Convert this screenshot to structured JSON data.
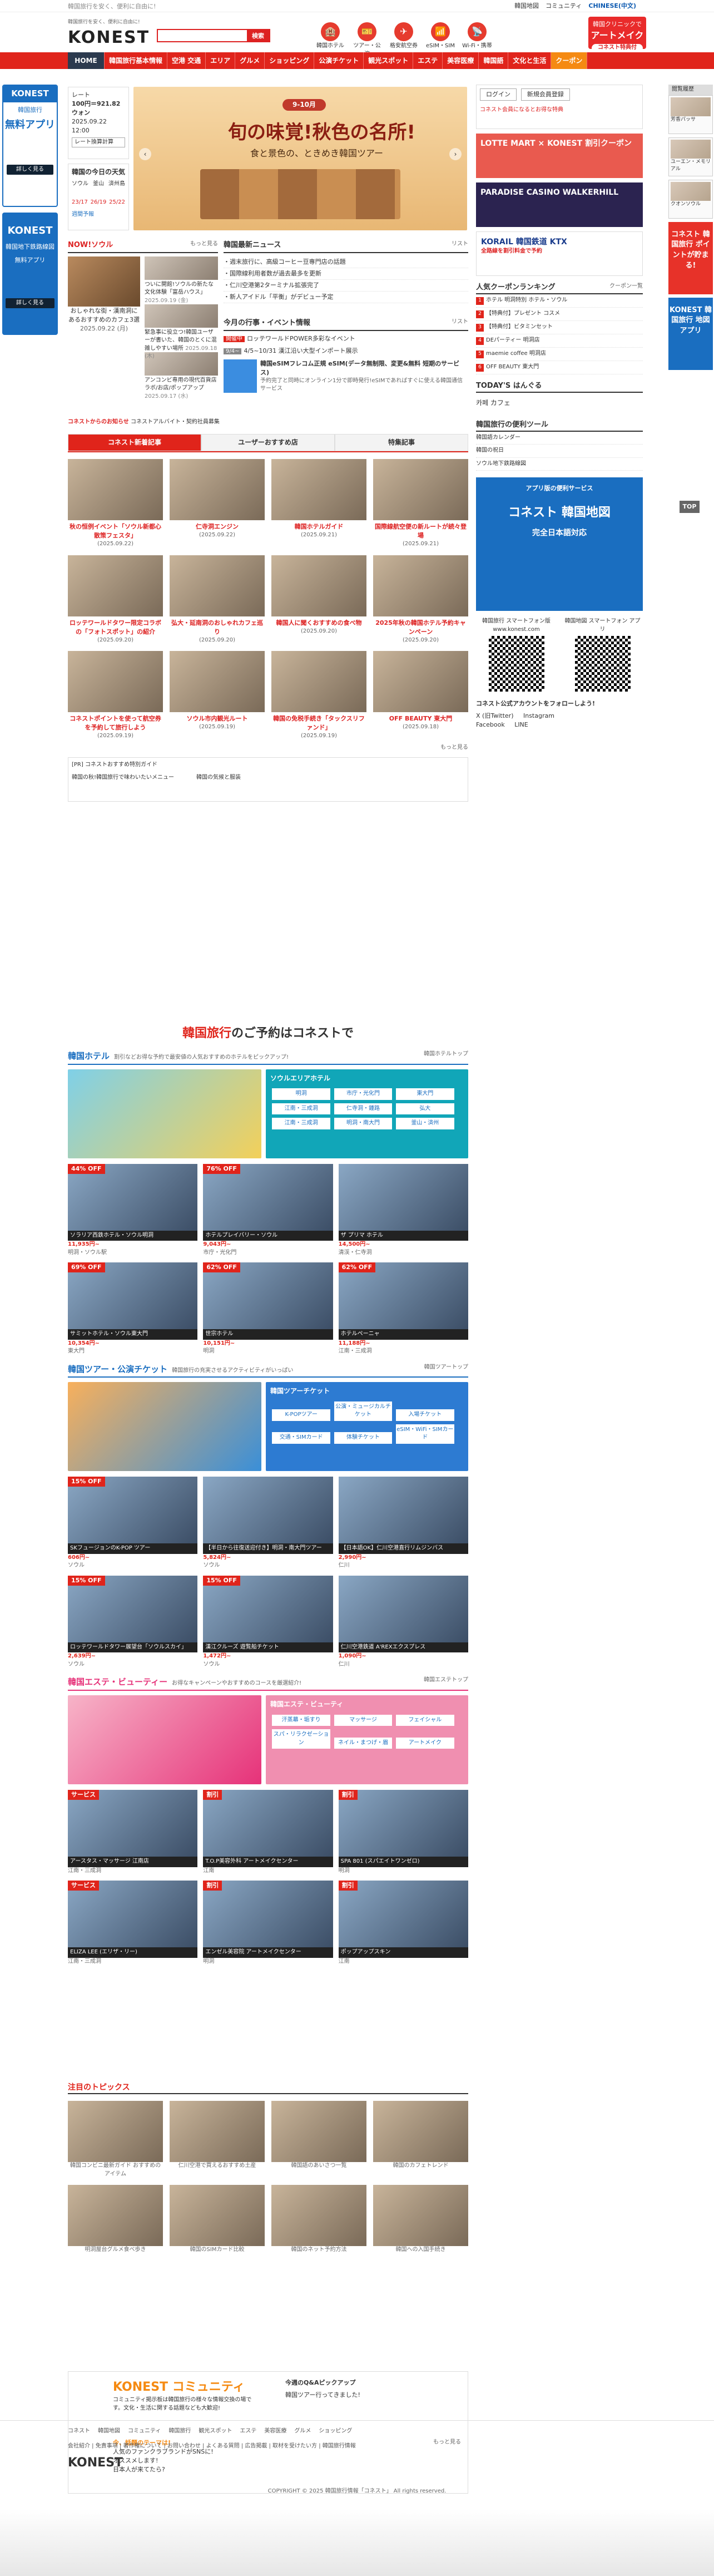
{
  "topbar": {
    "tagline": "韓国旅行を安く、便利に自由に!",
    "links": [
      "韓国地図",
      "コミュニティ",
      "CHINESE(中文)"
    ]
  },
  "header": {
    "logo_small": "韓国旅行を安く、便利に自由に!",
    "logo": "KONEST",
    "search_placeholder": "",
    "search_button": "検索",
    "icons": [
      {
        "label": "韓国ホテル",
        "icon": "hotel-icon",
        "glyph": "🏨"
      },
      {
        "label": "ツアー・公演",
        "icon": "ticket-icon",
        "glyph": "🎫"
      },
      {
        "label": "格安航空券",
        "icon": "plane-icon",
        "glyph": "✈"
      },
      {
        "label": "eSIM・SIM",
        "icon": "sim-icon",
        "glyph": "📶"
      },
      {
        "label": "Wi-Fi・携帯",
        "icon": "wifi-icon",
        "glyph": "📡"
      }
    ],
    "promo_line1": "韓国クリニックで",
    "promo_line2": "アートメイク",
    "promo_line3": "コネスト特典付"
  },
  "nav": [
    "HOME",
    "韓国旅行基本情報",
    "空港 交通",
    "エリア",
    "グルメ",
    "ショッピング",
    "公演チケット",
    "観光スポット",
    "エステ",
    "美容医療",
    "韓国語",
    "文化と生活",
    "クーポン"
  ],
  "left_rail": {
    "b1_title": "KONEST",
    "b1_sub": "韓国旅行",
    "b1_big": "無料アプリ",
    "b1_btn": "詳しく見る",
    "b2_title": "KONEST",
    "b2_big": "韓国地下鉄路線図",
    "b2_sub": "無料アプリ",
    "b2_btn": "詳しく見る"
  },
  "right_rail": {
    "title": "閲覧履歴",
    "items": [
      "芳香パッサ",
      "ユーエン・メモリアル",
      "クオンソウル"
    ],
    "banner1": "コネスト 韓国旅行 ポイントが貯まる!",
    "banner2": "KONEST 韓国旅行 地図アプリ",
    "top": "TOP"
  },
  "rate": {
    "label": "レート",
    "value": "100円＝921.82ウォン",
    "date": "2025.09.22 12:00",
    "btn": "レート換算計算"
  },
  "weather": {
    "title": "韓国の今日の天気",
    "cities": [
      "ソウル",
      "釜山",
      "済州島"
    ],
    "temps": [
      "23/17",
      "26/19",
      "25/22"
    ],
    "link": "週間予報"
  },
  "hero": {
    "pill": "9-10月",
    "headline": "旬の味覚!秋色の名所!",
    "sub": "食と景色の、ときめき韓国ツアー"
  },
  "now_seoul": {
    "title": "NOW!ソウル",
    "more": "もっと見る",
    "main_caption": "おしゃれな街・漢南洞にあるおすすめのカフェ3選",
    "main_date": "2025.09.22 (月)",
    "items": [
      {
        "t": "ついに開館!ソウルの新たな文化体験「富岳ハウス」",
        "d": "2025.09.19 (金)"
      },
      {
        "t": "緊急事に役立つ!韓国ユーザーが書いた、韓国のとくに混雑しやすい場所",
        "d": "2025.09.18 (木)"
      },
      {
        "t": "アンコンビ専用の現代百貨店ラボ/お店/ポップアップ",
        "d": "2025.09.17 (水)"
      }
    ]
  },
  "news": {
    "title": "韓国最新ニュース",
    "more": "リスト",
    "items": [
      "・週末旅行に、高級コーヒー豆専門店の話題",
      "・国際線利用者数が過去最多を更新",
      "・仁川空港第2ターミナル拡張完了",
      "・新人アイドル「平衡」がデビュー予定"
    ]
  },
  "event": {
    "title": "今月の行事・イベント情報",
    "more": "リスト",
    "r1_lbl": "開催中",
    "r1": "ロッテワールドPOWER多彩なイベント",
    "r2_lbl": "9/4~",
    "r2": "4/5~10/31 漢江沿い大型インポート展示",
    "feat_title": "韓国eSIMフレコム正規 eSIM(データ無制限、変更&無料 短期のサービス)",
    "feat_desc": "予約完了と同時にオンライン1分で即時発行!eSIMであればすぐに使える韓国通信サービス"
  },
  "konest_info": {
    "label": "コネストからのお知らせ",
    "text": "コネストアルバイト・契約社員募集"
  },
  "article_tabs": [
    "コネスト新着記事",
    "ユーザーおすすめ店",
    "特集記事"
  ],
  "articles": [
    {
      "t": "秋の恒例イベント「ソウル新都心散策フェスタ」",
      "d": "(2025.09.22)"
    },
    {
      "t": "仁寺洞エンジン",
      "d": "(2025.09.22)"
    },
    {
      "t": "韓国ホテルガイド",
      "d": "(2025.09.21)"
    },
    {
      "t": "国際線航空便の新ルートが続々登場",
      "d": "(2025.09.21)"
    },
    {
      "t": "ロッテワールドタワー限定コラボの「フォトスポット」の紹介",
      "d": "(2025.09.20)"
    },
    {
      "t": "弘大・延南洞のおしゃれカフェ巡り",
      "d": "(2025.09.20)"
    },
    {
      "t": "韓国人に聞くおすすめの食べ物",
      "d": "(2025.09.20)"
    },
    {
      "t": "2025年秋の韓国ホテル予約キャンペーン",
      "d": "(2025.09.20)"
    },
    {
      "t": "コネストポイントを使って航空券を予約して旅行しよう",
      "d": "(2025.09.19)"
    },
    {
      "t": "ソウル市内観光ルート",
      "d": "(2025.09.19)"
    },
    {
      "t": "韓国の免税手続き「タックスリファンド」",
      "d": "(2025.09.19)"
    },
    {
      "t": "OFF BEAUTY 東大門",
      "d": "(2025.09.18)"
    }
  ],
  "articles_more": "もっと見る",
  "special_box": {
    "label": "[PR] コネストおすすめ特別ガイド",
    "a": "韓国の秋!韓国旅行で味わいたいメニュー",
    "b": "韓国の気候と服装"
  },
  "booking": {
    "title_pre": "韓国旅行",
    "title_post": "のご予約はコネストで",
    "hotel": {
      "title": "韓国ホテル",
      "sub": "割引などお得な予約で最安値の人気おすすめのホテルをピックアップ!",
      "more": "韓国ホテルトップ",
      "panel_title": "ソウルエリアホテル",
      "cells": [
        "明洞",
        "市庁・光化門",
        "東大門",
        "江南・三成洞",
        "仁寺洞・鍾路",
        "弘大",
        "江南・三成洞",
        "明洞・南大門",
        "釜山・済州"
      ]
    },
    "hotels": [
      {
        "off": "44% OFF",
        "name": "ソラリア西鉄ホテル・ソウル明洞",
        "price": "11,935円~",
        "loc": "明洞・ソウル駅"
      },
      {
        "off": "76% OFF",
        "name": "ホテルプレイバリー・ソウル",
        "price": "9,043円~",
        "loc": "市庁・光化門"
      },
      {
        "off": "",
        "name": "ザ プリマ ホテル",
        "price": "14,500円~",
        "loc": "清渓・仁寺洞"
      },
      {
        "off": "69% OFF",
        "name": "サミットホテル・ソウル東大門",
        "price": "10,354円~",
        "loc": "東大門"
      },
      {
        "off": "62% OFF",
        "name": "世宗ホテル",
        "price": "10,151円~",
        "loc": "明洞"
      },
      {
        "off": "62% OFF",
        "name": "ホテルペーニャ",
        "price": "11,188円~",
        "loc": "江南・三成洞"
      }
    ],
    "tour": {
      "title": "韓国ツアー・公演チケット",
      "sub": "韓国旅行の充実させるアクティビティがいっぱい",
      "more": "韓国ツアートップ",
      "panel_title": "韓国ツアーチケット",
      "cells": [
        "K-POPツアー",
        "公演・ミュージカルチケット",
        "入場チケット",
        "交通・SIMカード",
        "体験チケット",
        "eSIM・WiFi・SIMカード"
      ]
    },
    "tours": [
      {
        "off": "15% OFF",
        "name": "SKフュージョンのK-POP ツアー",
        "price": "606円~",
        "loc": "ソウル"
      },
      {
        "off": "",
        "name": "【半日から往復送迎付き】明洞・南大門ツアー",
        "price": "5,824円~",
        "loc": "ソウル"
      },
      {
        "off": "",
        "name": "【日本語OK】仁川空港直行リムジンバス",
        "price": "2,990円~",
        "loc": "仁川"
      },
      {
        "off": "15% OFF",
        "name": "ロッテワールドタワー展望台「ソウルスカイ」",
        "price": "2,639円~",
        "loc": "ソウル"
      },
      {
        "off": "15% OFF",
        "name": "漢江クルーズ 遊覧船チケット",
        "price": "1,472円~",
        "loc": "ソウル"
      },
      {
        "off": "",
        "name": "仁川空港鉄道 A'REXエクスプレス",
        "price": "1,090円~",
        "loc": "仁川"
      }
    ],
    "esthe": {
      "title": "韓国エステ・ビューティー",
      "sub": "お得なキャンペーンやおすすめのコースを厳選紹介!",
      "more": "韓国エステトップ",
      "panel_title": "韓国エステ・ビューティ",
      "cells": [
        "汗蒸幕・垢すり",
        "マッサージ",
        "フェイシャル",
        "スパ・リラクゼーション",
        "ネイル・まつげ・眉",
        "アートメイク"
      ]
    },
    "esthes": [
      {
        "off": "サービス",
        "name": "アースタス・マッサージ 江南店",
        "price": "",
        "loc": "江南・三成洞"
      },
      {
        "off": "割引",
        "name": "T.O.P美容外科 アートメイクセンター",
        "price": "",
        "loc": "江南"
      },
      {
        "off": "割引",
        "name": "SPA 801 (スパエイトワンゼロ)",
        "price": "",
        "loc": "明洞"
      },
      {
        "off": "サービス",
        "name": "ELIZA LEE (エリザ・リー)",
        "price": "",
        "loc": "江南・三成洞"
      },
      {
        "off": "割引",
        "name": "エンゼル美容院 アートメイクセンター",
        "price": "",
        "loc": "明洞"
      },
      {
        "off": "割引",
        "name": "ポップアップスキン",
        "price": "",
        "loc": "江南"
      }
    ]
  },
  "topics": {
    "title": "注目のトピックス",
    "items": [
      "韓国コンビニ最新ガイド おすすめのアイテム",
      "仁川空港で買えるおすすめ土産",
      "韓国語のあいさつ一覧",
      "韓国のカフェトレンド",
      "明洞屋台グルメ食べ歩き",
      "韓国のSIMカード比較",
      "韓国のネット予約方法",
      "韓国への入国手続き"
    ]
  },
  "community": {
    "title": "KONEST",
    "title2": "コミュニティ",
    "desc": "コミュニティ掲示板は韓国旅行の様々な情報交換の場です。文化・生活に関する話題なども大歓迎!",
    "pick_title": "今週のQ&Aピックアップ",
    "pick": "韓国ツアー行ってきました!",
    "more": "もっと見る",
    "today": "今、話題のテーマは!",
    "list": [
      "人気のファンクラブランドがSNSに!",
      "オススメします!",
      "日本人が来てたら?"
    ]
  },
  "side": {
    "login": "ログイン",
    "register": "新規会員登録",
    "login_note": "コネスト会員になるとお得な特典",
    "banner1": "LOTTE MART × KONEST 割引クーポン",
    "banner2": "PARADISE CASINO WALKERHILL",
    "banner3": "KORAIL 韓国鉄道 KTX",
    "banner3_sub": "全路線を割引料金で予約",
    "rank_title": "人気クーポンランキング",
    "rank_more": "クーポン一覧",
    "rank": [
      "ホテル 明洞特別 ホテル・ソウル",
      "【特典付】プレゼント コスメ",
      "【特典付】ビタミンセット",
      "DEパーティー 明洞店",
      "maemie coffee 明洞店",
      "OFF BEAUTY 東大門"
    ],
    "today_title": "TODAY'S はんぐる",
    "today_word": "카페 カフェ",
    "guide_title": "韓国旅行の便利ツール",
    "guide": [
      "韓国語カレンダー",
      "韓国の祝日",
      "ソウル地下鉄路線図"
    ],
    "app_title": "アプリ版の便利サービス",
    "app_big": "コネスト 韓国地図",
    "app_sub": "完全日本語対応",
    "qr1": "韓国旅行 スマートフォン版 www.konest.com",
    "qr2": "韓国地図 スマートフォン アプリ",
    "follow": "コネスト公式アカウントをフォローしよう!",
    "sns": [
      "X (旧Twitter)",
      "Instagram",
      "Facebook",
      "LINE"
    ]
  },
  "footer": {
    "links": [
      "コネスト",
      "韓国地図",
      "コミュニティ",
      "韓国旅行",
      "観光スポット",
      "エステ",
      "美容医療",
      "グルメ",
      "ショッピング"
    ],
    "links2": "会社紹介 | 免責事項 | 著作権について | お問い合わせ | よくある質問 | 広告掲載 | 取材を受けたい方 | 韓国旅行情報",
    "logo": "KONEST",
    "copyright": "COPYRIGHT © 2025 韓国旅行情報「コネスト」 All rights reserved."
  },
  "colors": {
    "brand_red": "#e0241b",
    "accent_blue": "#1a6ec0",
    "coupon_orange": "#f58a12",
    "esthe_pink": "#e63279"
  }
}
